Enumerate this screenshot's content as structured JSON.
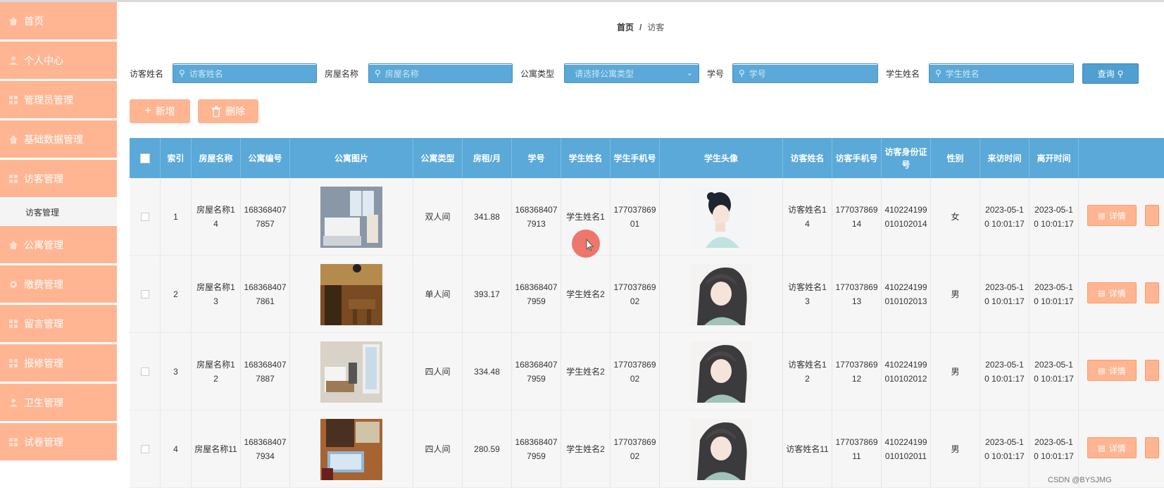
{
  "sidebar": {
    "items": [
      {
        "label": "首页"
      },
      {
        "label": "个人中心"
      },
      {
        "label": "管理员管理"
      },
      {
        "label": "基础数据管理"
      },
      {
        "label": "访客管理"
      },
      {
        "label": "公寓管理"
      },
      {
        "label": "缴费管理"
      },
      {
        "label": "留言管理"
      },
      {
        "label": "报修管理"
      },
      {
        "label": "卫生管理"
      },
      {
        "label": "试卷管理"
      }
    ],
    "sub_item": "访客管理"
  },
  "breadcrumb": {
    "home": "首页",
    "separator": "/",
    "current": "访客"
  },
  "search": {
    "visitor_name": {
      "label": "访客姓名",
      "placeholder": "访客姓名"
    },
    "house_name": {
      "label": "房屋名称",
      "placeholder": "房屋名称"
    },
    "apt_type": {
      "label": "公寓类型",
      "placeholder": "请选择公寓类型"
    },
    "student_no": {
      "label": "学号",
      "placeholder": "学号"
    },
    "student_name": {
      "label": "学生姓名",
      "placeholder": "学生姓名"
    },
    "query_label": "查询"
  },
  "actions": {
    "add_label": "新增",
    "delete_label": "删除"
  },
  "table": {
    "headers": [
      "索引",
      "房屋名称",
      "公寓编号",
      "公寓图片",
      "公寓类型",
      "房租/月",
      "学号",
      "学生姓名",
      "学生手机号",
      "学生头像",
      "访客姓名",
      "访客手机号",
      "访客身份证号",
      "性别",
      "来访时间",
      "离开时间"
    ],
    "rows": [
      {
        "index": "1",
        "house": "房屋名称14",
        "apt_no": "1683684077857",
        "apt_type": "双人间",
        "rent": "341.88",
        "student_no": "1683684077913",
        "student_name": "学生姓名1",
        "student_phone": "17703786901",
        "visitor_name": "访客姓名14",
        "visitor_phone": "17703786914",
        "visitor_id": "410224199010102014",
        "gender": "女",
        "arrive": "2023-05-10 10:01:17",
        "leave": "2023-05-10 10:01:17"
      },
      {
        "index": "2",
        "house": "房屋名称13",
        "apt_no": "1683684077861",
        "apt_type": "单人间",
        "rent": "393.17",
        "student_no": "1683684077959",
        "student_name": "学生姓名2",
        "student_phone": "17703786902",
        "visitor_name": "访客姓名13",
        "visitor_phone": "17703786913",
        "visitor_id": "410224199010102013",
        "gender": "男",
        "arrive": "2023-05-10 10:01:17",
        "leave": "2023-05-10 10:01:17"
      },
      {
        "index": "3",
        "house": "房屋名称12",
        "apt_no": "1683684077887",
        "apt_type": "四人间",
        "rent": "334.48",
        "student_no": "1683684077959",
        "student_name": "学生姓名2",
        "student_phone": "17703786902",
        "visitor_name": "访客姓名12",
        "visitor_phone": "17703786912",
        "visitor_id": "410224199010102012",
        "gender": "男",
        "arrive": "2023-05-10 10:01:17",
        "leave": "2023-05-10 10:01:17"
      },
      {
        "index": "4",
        "house": "房屋名称11",
        "apt_no": "1683684077934",
        "apt_type": "四人间",
        "rent": "280.59",
        "student_no": "1683684077959",
        "student_name": "学生姓名2",
        "student_phone": "17703786902",
        "visitor_name": "访客姓名11",
        "visitor_phone": "17703786911",
        "visitor_id": "410224199010102011",
        "gender": "男",
        "arrive": "2023-05-10 10:01:17",
        "leave": "2023-05-10 10:01:17"
      }
    ],
    "detail_label": "详情"
  },
  "watermark": "CSDN @BYSJMG",
  "colors": {
    "accent": "#ffb592",
    "header_blue": "#5aa9d8"
  }
}
